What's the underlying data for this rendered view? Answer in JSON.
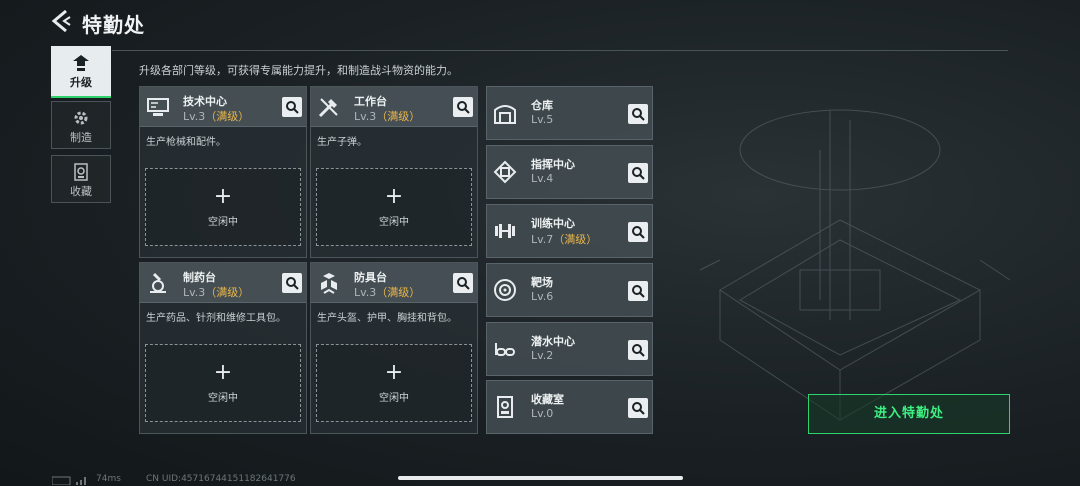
{
  "header": {
    "title": "特勤处",
    "back_icon": "back-arrow-icon"
  },
  "sidebar": {
    "items": [
      {
        "label": "升级",
        "icon": "upgrade-icon",
        "active": true
      },
      {
        "label": "制造",
        "icon": "gear-icon",
        "active": false
      },
      {
        "label": "收藏",
        "icon": "collection-icon",
        "active": false
      }
    ]
  },
  "description": "升级各部门等级，可获得专属能力提升，和制造战斗物资的能力。",
  "facilities": [
    {
      "name": "技术中心",
      "level": "Lv.3",
      "status": "（满级）",
      "desc": "生产枪械和配件。",
      "idle_plus": "+",
      "idle_label": "空闲中",
      "icon": "computer-icon"
    },
    {
      "name": "工作台",
      "level": "Lv.3",
      "status": "（满级）",
      "desc": "生产子弹。",
      "idle_plus": "+",
      "idle_label": "空闲中",
      "icon": "tools-icon"
    },
    {
      "name": "制药台",
      "level": "Lv.3",
      "status": "（满级）",
      "desc": "生产药品、针剂和维修工具包。",
      "idle_plus": "+",
      "idle_label": "空闲中",
      "icon": "microscope-icon"
    },
    {
      "name": "防具台",
      "level": "Lv.3",
      "status": "（满级）",
      "desc": "生产头盔、护甲、胸挂和背包。",
      "idle_plus": "+",
      "idle_label": "空闲中",
      "icon": "armor-boxes-icon"
    }
  ],
  "rooms": [
    {
      "name": "仓库",
      "level": "Lv.5",
      "status": "",
      "icon": "warehouse-icon"
    },
    {
      "name": "指挥中心",
      "level": "Lv.4",
      "status": "",
      "icon": "chip-icon"
    },
    {
      "name": "训练中心",
      "level": "Lv.7",
      "status": "（满级）",
      "icon": "dumbbell-icon"
    },
    {
      "name": "靶场",
      "level": "Lv.6",
      "status": "",
      "icon": "target-icon"
    },
    {
      "name": "潜水中心",
      "level": "Lv.2",
      "status": "",
      "icon": "diving-goggles-icon"
    },
    {
      "name": "收藏室",
      "level": "Lv.0",
      "status": "",
      "icon": "display-case-icon"
    }
  ],
  "enter_button": "进入特勤处",
  "footer": {
    "ping": "74ms",
    "uid": "CN UID:457167441511826417​76"
  },
  "colors": {
    "accent_green": "#2fd36b",
    "max_level_gold": "#e9b64b"
  }
}
